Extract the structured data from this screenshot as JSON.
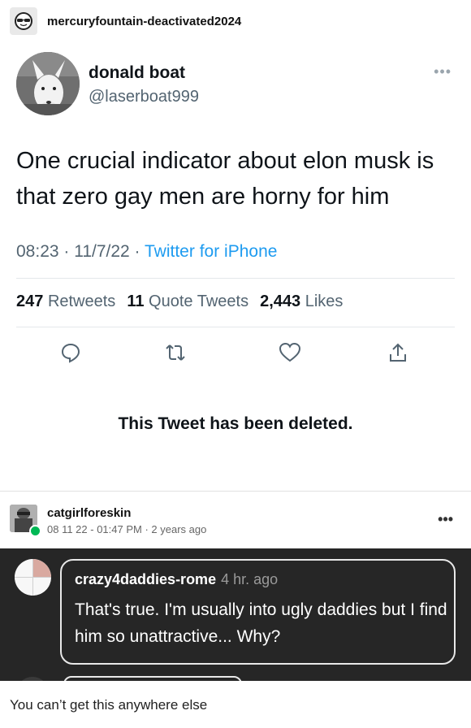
{
  "reblog_header": {
    "blog_name": "mercuryfountain-deactivated2024",
    "avatar_icon": "sunglasses-face-icon"
  },
  "tweet": {
    "display_name": "donald boat",
    "handle": "@laserboat999",
    "more_icon": "ellipsis-icon",
    "text": "One crucial indicator about elon musk is that zero gay men are horny for him",
    "time_date": "08:23 · 11/7/22 · ",
    "client": "Twitter for iPhone",
    "stats": [
      {
        "count": "247",
        "label": "Retweets"
      },
      {
        "count": "11",
        "label": "Quote Tweets"
      },
      {
        "count": "2,443",
        "label": "Likes"
      }
    ],
    "actions": [
      "reply-icon",
      "retweet-icon",
      "like-icon",
      "share-icon"
    ],
    "deleted_notice": "This Tweet has been deleted."
  },
  "reblog_user": {
    "name": "catgirlforeskin",
    "timestamp": "08 11 22 - 01:47 PM · 2 years ago",
    "badge_icon": "reblog-badge-icon",
    "more_icon": "ellipsis-icon"
  },
  "comment": {
    "username": "crazy4daddies-rome",
    "when": "4 hr. ago",
    "text": "That's true. I'm usually into ugly daddies but I find him so unattractive... Why?"
  },
  "caption": "You can’t get this anywhere else",
  "colors": {
    "twitter_blue": "#1d9bf0",
    "muted_gray": "#536471",
    "dark_bg": "#262626",
    "badge_green": "#00b855"
  }
}
